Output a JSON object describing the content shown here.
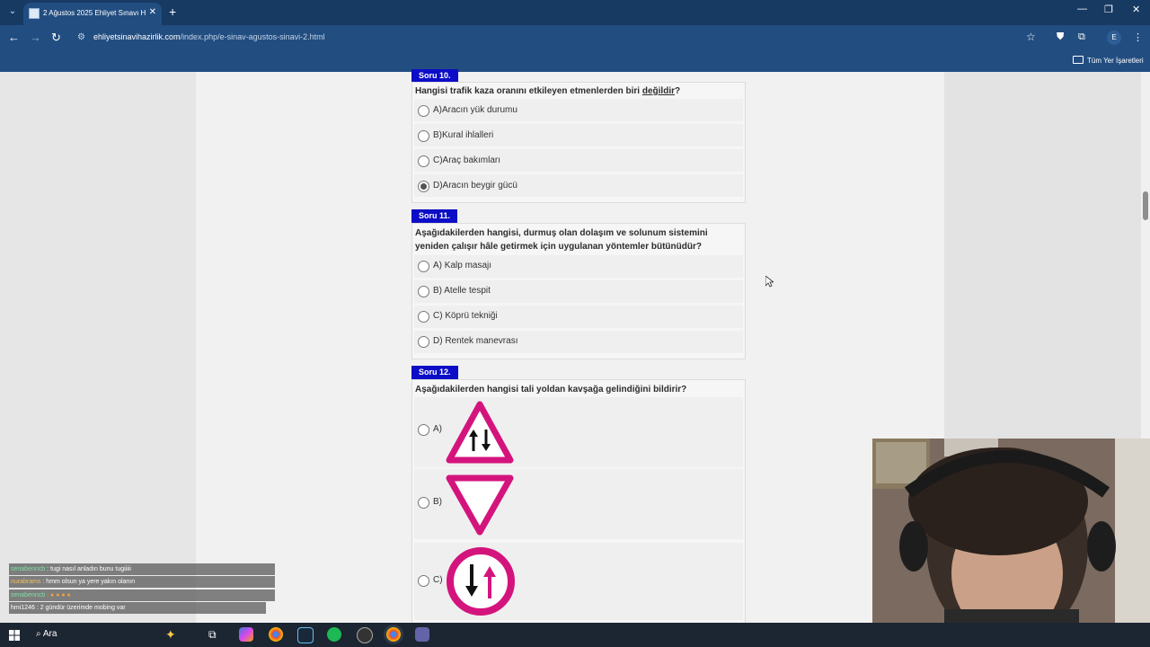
{
  "browser": {
    "tab_title": "2 Ağustos 2025 Ehliyet Sınavı H",
    "new_tab": "+",
    "tab_close": "✕",
    "url_host": "ehliyetsinavihazirlik.com",
    "url_path": "/index.php/e-sinav-agustos-sinavi-2.html",
    "profile_initial": "E",
    "bookmarks_folder": "Tüm Yer İşaretleri"
  },
  "questions": [
    {
      "label": "Soru 10.",
      "text": "Hangisi trafik kaza oranını etkileyen etmenlerden biri ",
      "text_underlined": "değildir",
      "text_suffix": "?",
      "options": [
        "A)Aracın yük durumu",
        "B)Kural ihlalleri",
        "C)Araç bakımları",
        "D)Aracın beygir gücü"
      ],
      "selected": 3
    },
    {
      "label": "Soru 11.",
      "text_line1": "Aşağıdakilerden hangisi, durmuş olan dolaşım ve solunum sistemini",
      "text_line2": "yeniden çalışır hâle getirmek için uygulanan yöntemler bütünüdür?",
      "options": [
        "A) Kalp masajı",
        "B) Atelle tespit",
        "C) Köprü tekniği",
        "D) Rentek manevrası"
      ]
    },
    {
      "label": "Soru 12.",
      "text": "Aşağıdakilerden hangisi tali yoldan kavşağa gelindiğini bildirir?",
      "options": [
        {
          "label": "A)",
          "sign": "two-way-traffic-triangle-sign"
        },
        {
          "label": "B)",
          "sign": "give-way-inverted-triangle-sign"
        },
        {
          "label": "C)",
          "sign": "oncoming-priority-circle-sign"
        }
      ]
    }
  ],
  "chat": [
    {
      "user": "senabenncb",
      "message": ": tugi nasıl anladın bunu tugiiiii"
    },
    {
      "user": "nurabrams",
      "message": ": hmm olsun ya yere yakın olanın"
    },
    {
      "user": "senabenncb",
      "message": ": ● ● ● ●"
    },
    {
      "user": "hmi1246",
      "message": ": 2 gündür üzerimde mobing var"
    }
  ],
  "taskbar": {
    "search_label": "Ara"
  },
  "colors": {
    "question_label_bg": "#0d0dc7",
    "sign_magenta": "#d4147d",
    "browser_blue": "#224d80"
  }
}
